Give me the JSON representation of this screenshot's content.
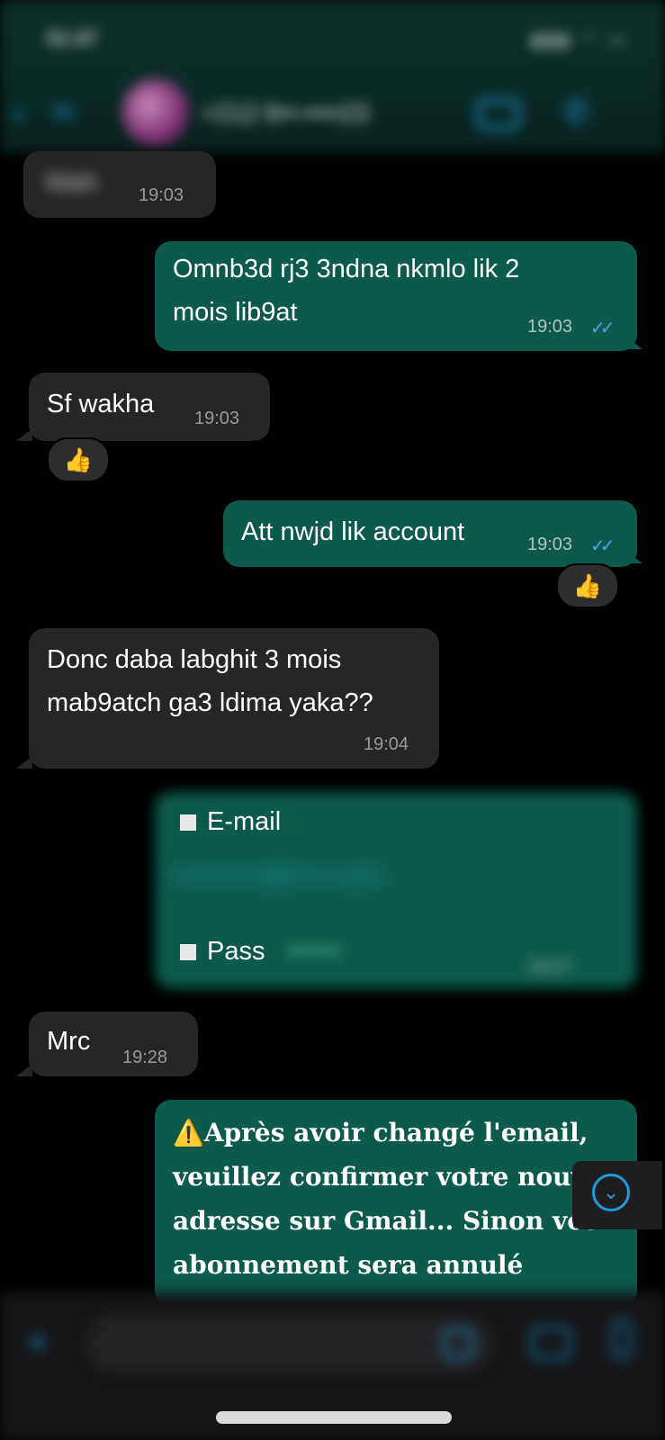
{
  "header": {
    "status_time": "01:47",
    "status_icons": "▮▮▮ ◠ ▭",
    "back_count": "50",
    "contact_name": "+212 6••-••••23"
  },
  "messages": [
    {
      "dir": "in",
      "text": "Wah",
      "time": "19:03"
    },
    {
      "dir": "out",
      "text_line1": "Omnb3d rj3 3ndna nkmlo lik 2",
      "text_line2": "mois lib9at",
      "time": "19:03"
    },
    {
      "dir": "in",
      "text": "Sf wakha",
      "time": "19:03",
      "reaction": "👍"
    },
    {
      "dir": "out",
      "text": "Att nwjd lik account",
      "time": "19:03",
      "reaction": "👍"
    },
    {
      "dir": "in",
      "text_line1": "Donc daba labghit 3 mois",
      "text_line2": "mab9atch ga3 ldima yaka??",
      "time": "19:04"
    },
    {
      "dir": "out",
      "email_label": "E-mail",
      "email_colon": ":",
      "email_value": "••••••••••@••••.com",
      "pass_label": "Pass",
      "pass_value": "••••••",
      "time": "19:27"
    },
    {
      "dir": "in",
      "text": "Mrc",
      "time": "19:28"
    },
    {
      "dir": "out",
      "warning_icon": "⚠️",
      "line1": "Après avoir changé l'email,",
      "line2": "veuillez confirmer votre nouve",
      "line3": "adresse sur Gmail... Sinon votr",
      "line4": "abonnement sera annulé"
    }
  ],
  "ticks": "✓✓",
  "scroll_down_icon": "⌄",
  "composer": {
    "plus_icon": "+",
    "input_placeholder": ""
  },
  "colors": {
    "incoming_bubble": "#262628",
    "outgoing_bubble": "#0b5a4b",
    "accent": "#1e9bd9",
    "read_ticks": "#4aa9e6"
  }
}
